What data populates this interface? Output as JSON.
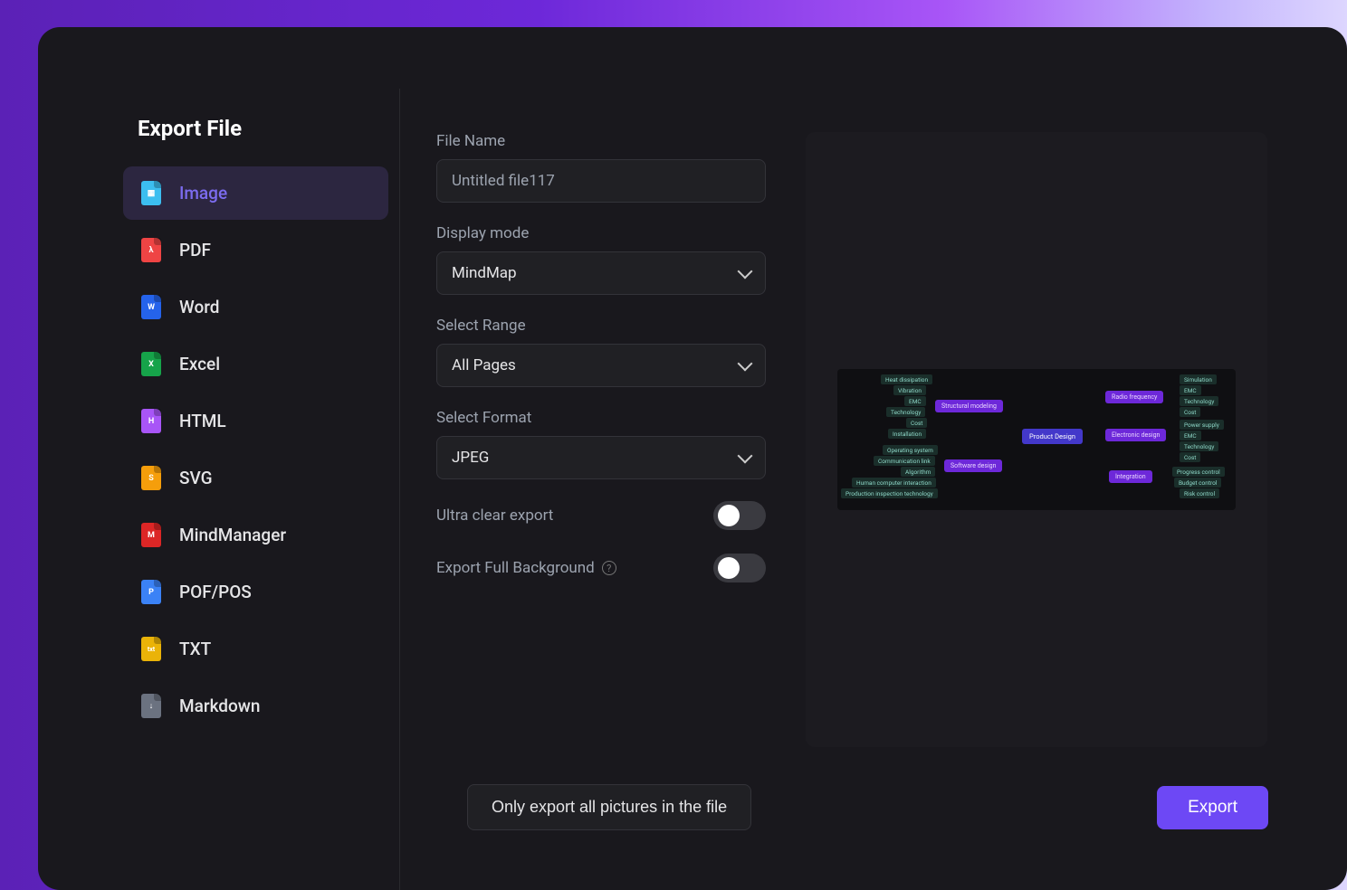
{
  "title": "Export File",
  "sidebar": {
    "items": [
      {
        "label": "Image",
        "icon": "img",
        "active": true
      },
      {
        "label": "PDF",
        "icon": "pdf"
      },
      {
        "label": "Word",
        "icon": "w"
      },
      {
        "label": "Excel",
        "icon": "x"
      },
      {
        "label": "HTML",
        "icon": "h"
      },
      {
        "label": "SVG",
        "icon": "s"
      },
      {
        "label": "MindManager",
        "icon": "m"
      },
      {
        "label": "POF/POS",
        "icon": "p"
      },
      {
        "label": "TXT",
        "icon": "txt"
      },
      {
        "label": "Markdown",
        "icon": "↓"
      }
    ]
  },
  "form": {
    "filename_label": "File Name",
    "filename_value": "Untitled file117",
    "display_mode_label": "Display mode",
    "display_mode_value": "MindMap",
    "range_label": "Select Range",
    "range_value": "All Pages",
    "format_label": "Select Format",
    "format_value": "JPEG",
    "ultra_label": "Ultra clear export",
    "fullbg_label": "Export Full Background"
  },
  "preview": {
    "center": "Product Design",
    "branches": {
      "structural": {
        "label": "Structural modeling",
        "leaves": [
          "Heat dissipation",
          "Vibration",
          "EMC",
          "Technology",
          "Cost",
          "Installation"
        ]
      },
      "software": {
        "label": "Software design",
        "leaves": [
          "Operating system",
          "Communication link",
          "Algorithm",
          "Human computer interaction",
          "Production inspection technology"
        ]
      },
      "radio": {
        "label": "Radio frequency",
        "leaves": [
          "Simulation",
          "EMC",
          "Technology",
          "Cost"
        ]
      },
      "electronic": {
        "label": "Electronic design",
        "leaves": [
          "Power supply",
          "EMC",
          "Technology",
          "Cost"
        ]
      },
      "integration": {
        "label": "Integration",
        "leaves": [
          "Progress control",
          "Budget control",
          "Risk control"
        ]
      }
    }
  },
  "footer": {
    "secondary": "Only export all pictures in the file",
    "primary": "Export"
  }
}
